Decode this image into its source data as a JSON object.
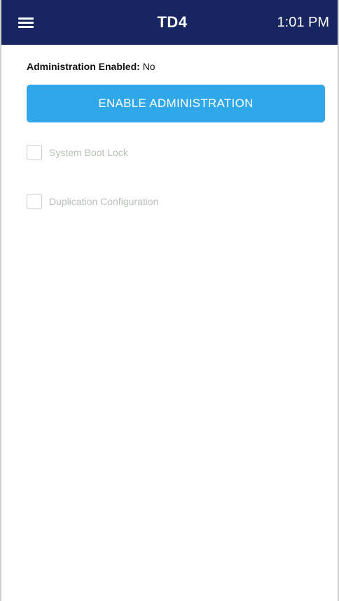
{
  "header": {
    "title": "TD4",
    "time": "1:01 PM",
    "menu_icon": "hamburger-menu-icon",
    "background_color": "#172561"
  },
  "admin": {
    "status_label": "Administration Enabled:",
    "status_value": "No",
    "enable_button_label": "ENABLE ADMINISTRATION",
    "button_color": "#2fa7e8"
  },
  "options": [
    {
      "label": "System Boot Lock",
      "checked": false,
      "enabled": false
    },
    {
      "label": "Duplication Configuration",
      "checked": false,
      "enabled": false
    }
  ]
}
